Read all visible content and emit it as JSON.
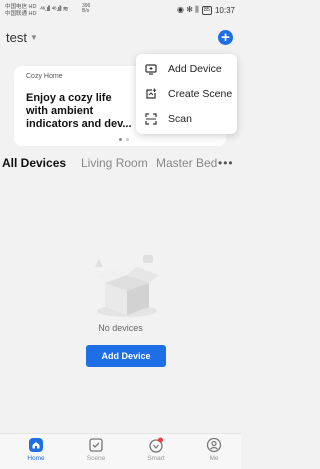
{
  "status": {
    "carrier1": "中国电信 HD",
    "carrier2": "中国联通 HD",
    "signal": "⁴⁶.ıll ⁴⁶.ıll ≋",
    "speed_value": "396",
    "speed_unit": "B/s",
    "icons": "◉ ✻ ⫼",
    "battery": "85",
    "time": "10:37"
  },
  "header": {
    "home_name": "test",
    "add_icon": "plus-icon"
  },
  "banner": {
    "label": "Cozy Home",
    "title": "Enjoy a cozy life with ambient indicators and dev..."
  },
  "popup_menu": {
    "items": [
      {
        "label": "Add Device",
        "icon": "add-device-icon"
      },
      {
        "label": "Create Scene",
        "icon": "create-scene-icon"
      },
      {
        "label": "Scan",
        "icon": "scan-icon"
      }
    ]
  },
  "room_tabs": {
    "tabs": [
      "All Devices",
      "Living Room",
      "Master Bed"
    ],
    "more": "•••"
  },
  "empty_state": {
    "message": "No devices",
    "button": "Add Device"
  },
  "bottom_nav": {
    "items": [
      {
        "label": "Home",
        "icon": "home-icon"
      },
      {
        "label": "Scene",
        "icon": "scene-icon"
      },
      {
        "label": "Smart",
        "icon": "smart-icon"
      },
      {
        "label": "Me",
        "icon": "me-icon"
      }
    ]
  },
  "colors": {
    "accent": "#1e6fe6",
    "background": "#f2f2f2",
    "notification_dot": "#e64340"
  }
}
